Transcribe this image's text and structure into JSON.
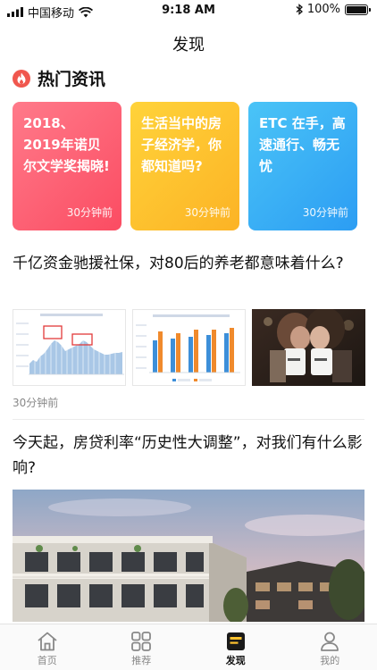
{
  "status_bar": {
    "carrier": "中国移动",
    "time": "9:18 AM",
    "battery": "100%",
    "battery_level": 1.0
  },
  "nav": {
    "title": "发现"
  },
  "hot_news": {
    "title": "热门资讯",
    "cards": [
      {
        "text": "2018、2019年诺贝尔文学奖揭晓!",
        "time": "30分钟前"
      },
      {
        "text": "生活当中的房子经济学，你都知道吗?",
        "time": "30分钟前"
      },
      {
        "text": "ETC 在手，高速通行、畅无忧",
        "time": "30分钟前"
      }
    ]
  },
  "articles": [
    {
      "title": "千亿资金驰援社保，对80后的养老都意味着什么?",
      "time": "30分钟前"
    },
    {
      "title": "今天起，房贷利率“历史性大调整”，对我们有什么影响?"
    }
  ],
  "tabs": [
    {
      "label": "首页",
      "icon": "home-icon"
    },
    {
      "label": "推荐",
      "icon": "grid-icon"
    },
    {
      "label": "发现",
      "icon": "discover-icon",
      "active": true
    },
    {
      "label": "我的",
      "icon": "user-icon"
    }
  ],
  "colors": {
    "accent_red": "#fb4c62",
    "accent_yellow": "#fcb325",
    "accent_blue": "#2c9df3",
    "fire": "#f0574e"
  }
}
